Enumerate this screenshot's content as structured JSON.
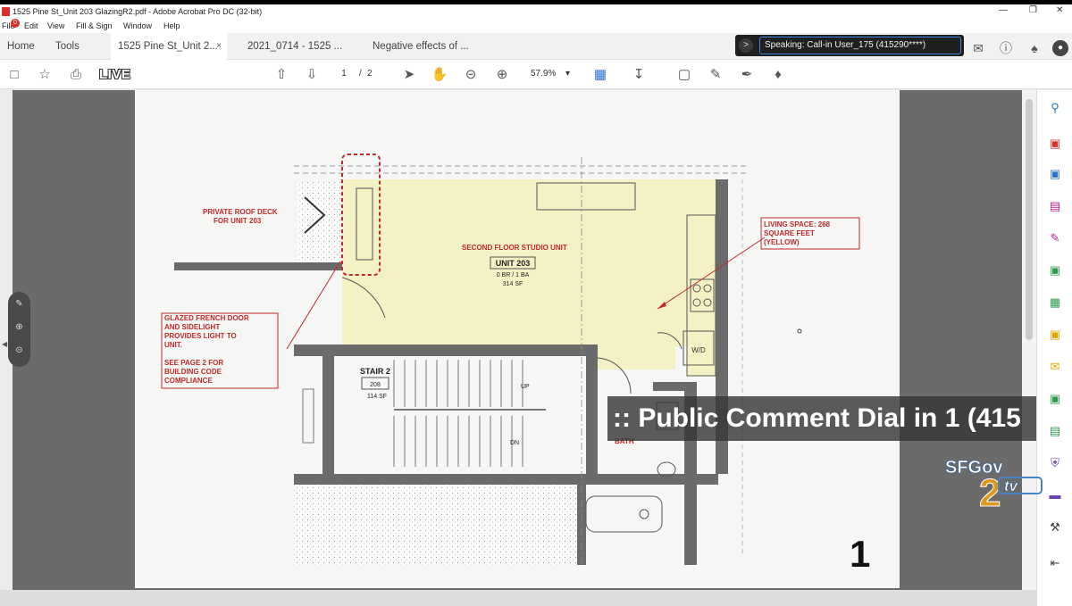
{
  "window": {
    "title": "1525 Pine St_Unit 203 GlazingR2.pdf - Adobe Acrobat Pro DC (32-bit)",
    "controls": [
      "—",
      "❐",
      "✕"
    ]
  },
  "menu": {
    "file": "File",
    "edit": "Edit",
    "view": "View",
    "fill_sign": "Fill & Sign",
    "window": "Window",
    "help": "Help",
    "badge": "0"
  },
  "tabs": {
    "home": "Home",
    "tools": "Tools",
    "doc1": "1525 Pine St_Unit 2...",
    "doc2": "2021_0714 - 1525 ...",
    "doc3": "Negative effects of ...",
    "close": "×"
  },
  "speaking": {
    "chevron": ">",
    "text": "Speaking: Call-in User_175 (415290****)"
  },
  "toolbar": {
    "live": "LIVE",
    "current_page": "1",
    "page_sep": "/",
    "total_pages": "2",
    "zoom": "57.9%",
    "zoom_caret": "▾"
  },
  "plan": {
    "roof_deck_1": "PRIVATE ROOF DECK",
    "roof_deck_2": "FOR UNIT 203",
    "studio_label": "SECOND FLOOR STUDIO UNIT",
    "unit_name": "UNIT 203",
    "unit_rooms": "0 BR / 1 BA",
    "unit_sf": "314 SF",
    "living_1": "LIVING SPACE: 268",
    "living_2": "SQUARE FEET",
    "living_3": "(YELLOW)",
    "glazed_1": "GLAZED FRENCH DOOR",
    "glazed_2": "AND SIDELIGHT",
    "glazed_3": "PROVIDES LIGHT TO",
    "glazed_4": "UNIT.",
    "glazed_5": "SEE PAGE 2 FOR",
    "glazed_6": "BUILDING CODE",
    "glazed_7": "COMPLIANCE",
    "stair_label": "STAIR 2",
    "stair_num": "208",
    "stair_sf": "114 SF",
    "up": "UP",
    "dn": "DN",
    "wd": "W/D",
    "bath": "BATH"
  },
  "overlay": {
    "public_comment": ":: Public Comment Dial in 1 (415",
    "logo_sf": "SFGov",
    "logo_num": "2",
    "logo_tv": "tv",
    "page_number": "1"
  },
  "colors": {
    "accent_red": "#c0292a",
    "yellow_fill": "#f4f1c4",
    "speaking_border": "#3b86d8"
  }
}
